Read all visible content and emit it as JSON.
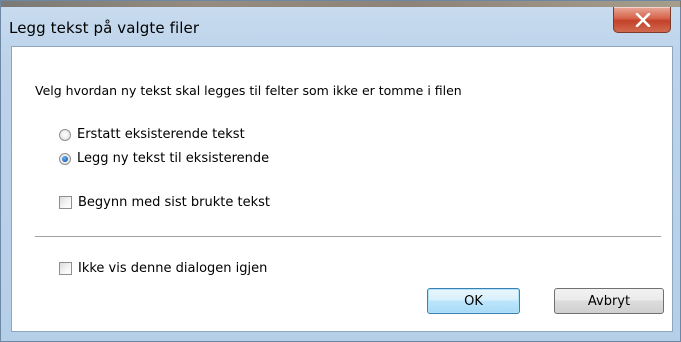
{
  "window": {
    "title": "Legg tekst på valgte filer",
    "close_symbol": "X"
  },
  "dialog": {
    "instruction": "Velg hvordan ny tekst skal legges til felter som ikke er tomme i filen",
    "radio_options": [
      {
        "label": "Erstatt eksisterende tekst",
        "selected": false
      },
      {
        "label": "Legg ny tekst til eksisterende",
        "selected": true
      }
    ],
    "checkbox_start_last": {
      "label": "Begynn med sist brukte tekst",
      "checked": false
    },
    "checkbox_dont_show": {
      "label": "Ikke vis denne dialogen igjen",
      "checked": false
    }
  },
  "buttons": {
    "ok_label": "OK",
    "cancel_label": "Avbryt"
  },
  "colors": {
    "frame": "#bcd3ea",
    "close_button": "#c3412a",
    "radio_selected": "#1c65b8",
    "default_button_border": "#3c7fb1"
  }
}
